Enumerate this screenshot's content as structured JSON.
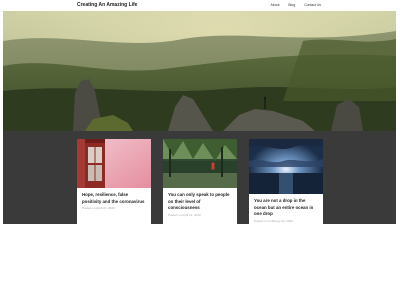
{
  "header": {
    "site_title": "Creating An Amazing Life",
    "nav": [
      "About",
      "Blog",
      "Contact Us"
    ]
  },
  "hero": {
    "image": "mountain-valley-landscape"
  },
  "posts": [
    {
      "title": "Hope, resilience, false positivity and the coronavirus",
      "meta": "Posted on April 21, 2020",
      "image": "red-phone-booth"
    },
    {
      "title": "You can only speak to people on their level of consciousness",
      "meta": "Posted on April 13, 2020",
      "image": "forest-person-red-jacket"
    },
    {
      "title": "You are not a drop in the ocean but an entire ocean in one drop",
      "meta": "Posted on February 12, 2020",
      "image": "sunset-ocean-clouds"
    }
  ],
  "colors": {
    "band": "#3a3a3a",
    "text": "#222222",
    "meta": "#aaaaaa"
  }
}
